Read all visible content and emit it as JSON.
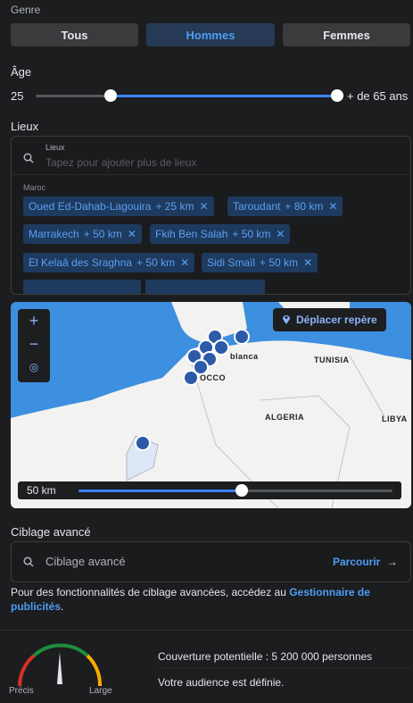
{
  "gender": {
    "label": "Genre",
    "options": [
      "Tous",
      "Hommes",
      "Femmes"
    ],
    "selected": "Hommes"
  },
  "age": {
    "label": "Âge",
    "min_value": "25",
    "max_value": "+ de 65 ans"
  },
  "locations": {
    "label": "Lieux",
    "search_label": "Lieux",
    "search_placeholder": "Tapez pour ajouter plus de lieux",
    "country": "Maroc",
    "chips": [
      {
        "name": "Oued Ed-Dahab-Lagouira",
        "radius": "+ 25 km"
      },
      {
        "name": "Taroudant",
        "radius": "+ 80 km"
      },
      {
        "name": "Marrakech",
        "radius": "+ 50 km"
      },
      {
        "name": "Fkih Ben Salah",
        "radius": "+ 50 km"
      },
      {
        "name": "El Kelaâ des Sraghna",
        "radius": "+ 50 km"
      },
      {
        "name": "Sidi Smaïl",
        "radius": "+ 50 km"
      }
    ],
    "remove_glyph": "✕"
  },
  "map": {
    "zoom_in": "+",
    "zoom_out": "−",
    "move_pin_label": "Déplacer repère",
    "labels": [
      "blanca",
      "TUNISIA",
      "OCCO",
      "ALGERIA",
      "LIBYA"
    ],
    "radius_value": "50 km",
    "radius_fraction": 0.52,
    "water_color": "#3d8fe0",
    "land_color": "#f2f2f0"
  },
  "advanced": {
    "label": "Ciblage avancé",
    "search_placeholder": "Ciblage avancé",
    "browse_label": "Parcourir",
    "note_prefix": "Pour des fonctionnalités de ciblage avancées, accédez au ",
    "note_link": "Gestionnaire de publicités",
    "note_suffix": "."
  },
  "audience": {
    "gauge_left": "Précis",
    "gauge_right": "Large",
    "coverage": "Couverture potentielle : 5 200 000 personnes",
    "status": "Votre audience est définie."
  },
  "colors": {
    "accent": "#4c9df5",
    "chip_bg": "#1e3a5f",
    "background": "#1c1d1f"
  }
}
